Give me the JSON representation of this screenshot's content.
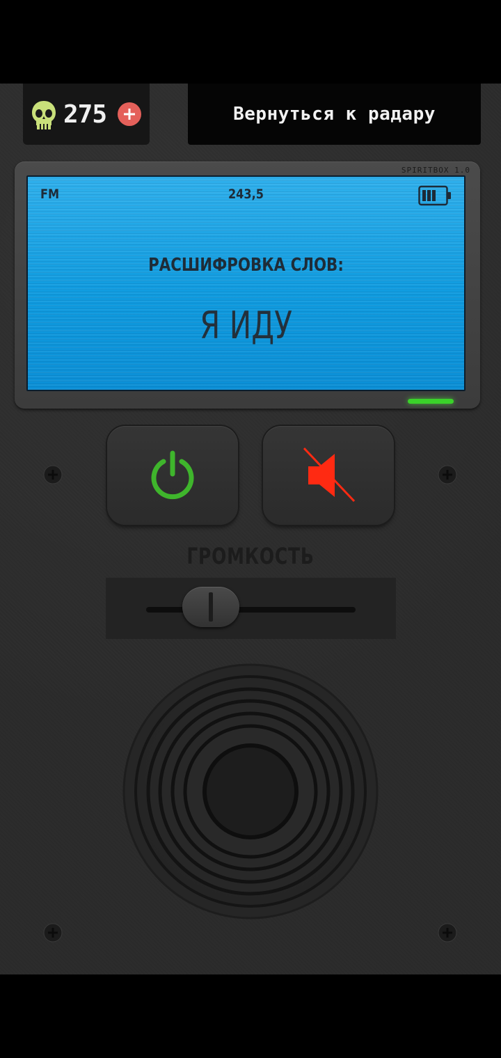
{
  "header": {
    "coin_value": "275",
    "coin_icon": "skull-icon",
    "add_icon": "plus-icon",
    "back_label": "Вернуться к радару"
  },
  "device": {
    "model_label": "SPIRITBOX 1.0"
  },
  "screen": {
    "band": "FM",
    "frequency": "243,5",
    "battery_icon": "battery-icon",
    "decode_label": "РАСШИФРОВКА СЛОВ:",
    "decoded_word": "Я ИДУ",
    "indicator_color": "#3ad22a"
  },
  "controls": {
    "power_icon": "power-icon",
    "power_color": "#3fb52c",
    "mute_icon": "speaker-muted-icon",
    "mute_color": "#ff2a12",
    "volume_label": "ГРОМКОСТЬ",
    "volume_level": 0.31
  }
}
